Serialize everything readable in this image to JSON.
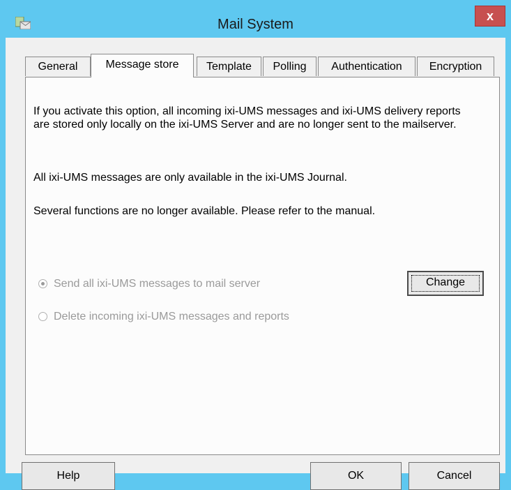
{
  "window": {
    "title": "Mail System",
    "close_label": "x"
  },
  "tabs": [
    {
      "label": "General"
    },
    {
      "label": "Message store"
    },
    {
      "label": "Template"
    },
    {
      "label": "Polling"
    },
    {
      "label": "Authentication"
    },
    {
      "label": "Encryption"
    }
  ],
  "active_tab": "Message store",
  "panel": {
    "description_1": "If you activate this option, all incoming ixi-UMS messages and ixi-UMS delivery reports are stored only locally on the ixi-UMS Server and are no longer sent to the mailserver.",
    "description_2": "All ixi-UMS messages are only available in the ixi-UMS Journal.",
    "description_3": "Several functions are no longer available. Please refer to the manual.",
    "options": [
      {
        "label": "Send all ixi-UMS messages to mail server",
        "selected": true,
        "enabled": false
      },
      {
        "label": "Delete incoming ixi-UMS messages and reports",
        "selected": false,
        "enabled": false
      }
    ],
    "change_label": "Change"
  },
  "footer": {
    "help_label": "Help",
    "ok_label": "OK",
    "cancel_label": "Cancel"
  },
  "colors": {
    "title_bar": "#5ec8f0",
    "close_button": "#c75050",
    "dialog_bg": "#f0f0f0",
    "disabled_text": "#9a9a9a"
  },
  "icons": {
    "app_icon": "mail-system-icon",
    "close_icon": "close-icon"
  }
}
